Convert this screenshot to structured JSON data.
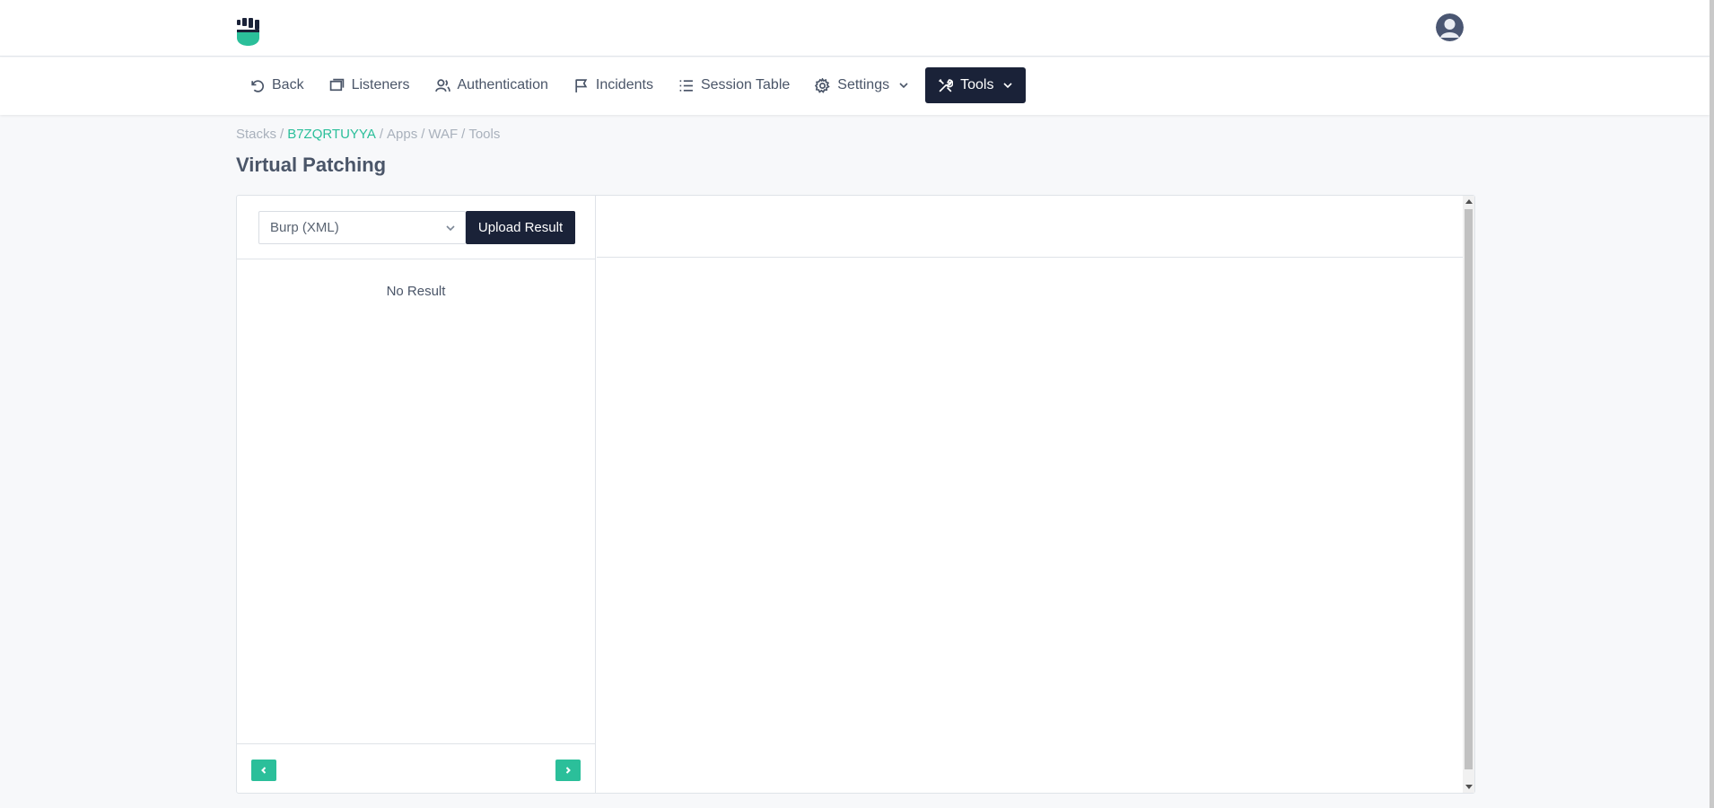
{
  "brand": {
    "accent": "#2bbf9a",
    "dark": "#1a2238",
    "logo_icon": "fist-shield-logo"
  },
  "user": {
    "avatar_icon": "user-avatar-icon"
  },
  "nav": {
    "items": [
      {
        "label": "Back",
        "icon": "back-arrow-icon"
      },
      {
        "label": "Listeners",
        "icon": "window-icon"
      },
      {
        "label": "Authentication",
        "icon": "users-icon"
      },
      {
        "label": "Incidents",
        "icon": "flag-icon"
      },
      {
        "label": "Session Table",
        "icon": "list-icon"
      },
      {
        "label": "Settings",
        "icon": "gear-icon"
      },
      {
        "label": "Tools",
        "icon": "tools-icon"
      }
    ],
    "active": "Tools"
  },
  "breadcrumb": {
    "items": [
      "Stacks",
      "B7ZQRTUYYA",
      "Apps",
      "WAF",
      "Tools"
    ],
    "separator": "/"
  },
  "page": {
    "title": "Virtual Patching"
  },
  "left_pane": {
    "format_select": {
      "value": "Burp (XML)"
    },
    "upload_label": "Upload Result",
    "empty_text": "No Result"
  }
}
